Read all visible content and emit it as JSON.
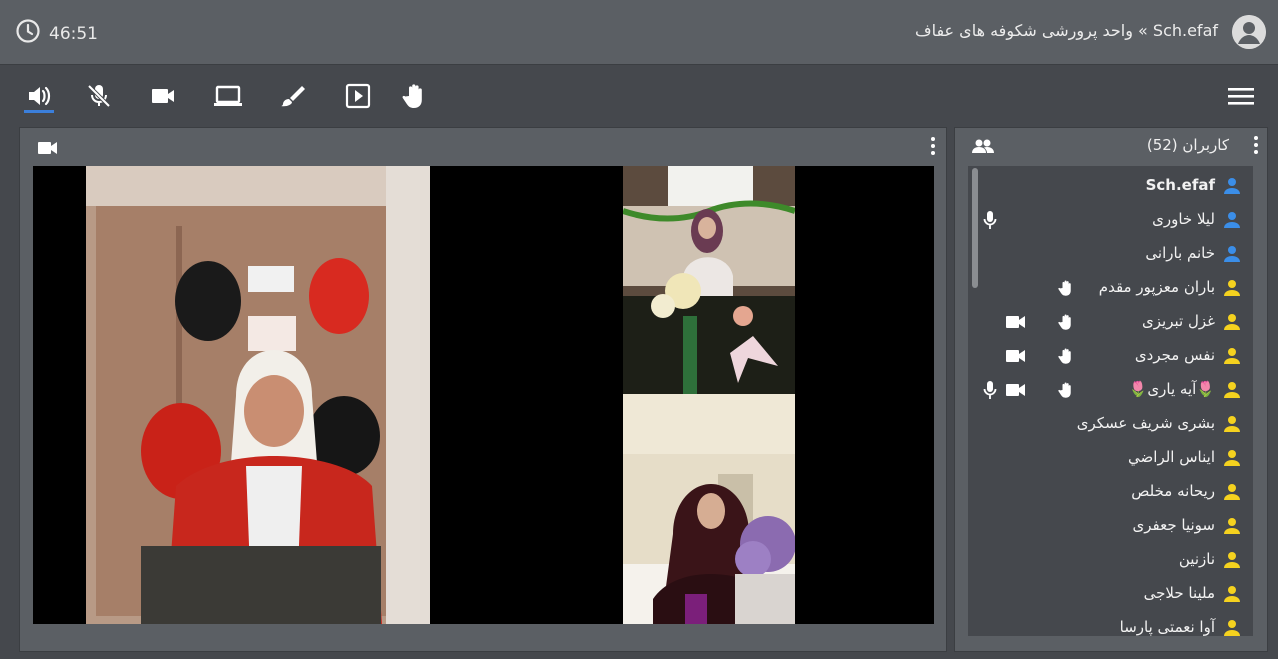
{
  "header": {
    "timer": "46:51",
    "title": "Sch.efaf » واحد پرورشی شکوفه های عفاف"
  },
  "toolbar": {
    "icons": [
      "speaker-icon",
      "mic-off-icon",
      "camera-icon",
      "screen-share-icon",
      "brush-icon",
      "play-icon",
      "hand-icon"
    ],
    "active": "speaker-icon",
    "accent": "#3b7fdb"
  },
  "video_panel": {
    "feeds": 3
  },
  "users_panel": {
    "title": "کاربران (52)",
    "users": [
      {
        "name": "Sch.efaf",
        "role": "moderator",
        "bold": true,
        "mic": false,
        "cam": false,
        "hand": false
      },
      {
        "name": "لیلا خاوری",
        "role": "moderator",
        "bold": false,
        "mic": true,
        "cam": false,
        "hand": false
      },
      {
        "name": "خانم بارانی",
        "role": "moderator",
        "bold": false,
        "mic": false,
        "cam": false,
        "hand": false
      },
      {
        "name": "باران معزپور مقدم",
        "role": "viewer",
        "bold": false,
        "mic": false,
        "cam": false,
        "hand": true
      },
      {
        "name": "غزل تبریزی",
        "role": "viewer",
        "bold": false,
        "mic": false,
        "cam": true,
        "hand": true
      },
      {
        "name": "نفس مجردی",
        "role": "viewer",
        "bold": false,
        "mic": false,
        "cam": true,
        "hand": true
      },
      {
        "name": "🌷آیه یاری🌷",
        "role": "viewer",
        "bold": false,
        "mic": true,
        "cam": true,
        "hand": true
      },
      {
        "name": "بشری شریف عسکری",
        "role": "viewer",
        "bold": false,
        "mic": false,
        "cam": false,
        "hand": false
      },
      {
        "name": "ایناس الراضي",
        "role": "viewer",
        "bold": false,
        "mic": false,
        "cam": false,
        "hand": false
      },
      {
        "name": "ریحانه مخلص",
        "role": "viewer",
        "bold": false,
        "mic": false,
        "cam": false,
        "hand": false
      },
      {
        "name": "سونیا جعفری",
        "role": "viewer",
        "bold": false,
        "mic": false,
        "cam": false,
        "hand": false
      },
      {
        "name": "نازنین",
        "role": "viewer",
        "bold": false,
        "mic": false,
        "cam": false,
        "hand": false
      },
      {
        "name": "ملینا حلاجی",
        "role": "viewer",
        "bold": false,
        "mic": false,
        "cam": false,
        "hand": false
      },
      {
        "name": "آوا نعمتی پارسا",
        "role": "viewer",
        "bold": false,
        "mic": false,
        "cam": false,
        "hand": false
      }
    ],
    "colors": {
      "moderator": "#3b8ee8",
      "viewer": "#f5d21f"
    }
  }
}
